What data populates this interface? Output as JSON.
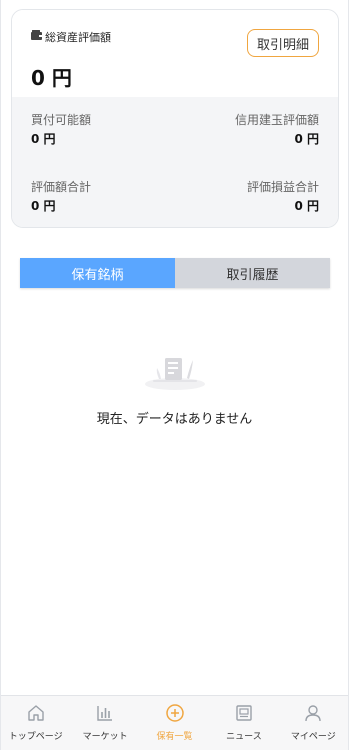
{
  "summary": {
    "total_label": "総資産評価額",
    "total_value": "0 円",
    "transaction_button": "取引明細",
    "metrics": {
      "buying_power_label": "買付可能額",
      "buying_power_value": "0 円",
      "margin_eval_label": "信用建玉評価額",
      "margin_eval_value": "0 円",
      "eval_total_label": "評価額合計",
      "eval_total_value": "0 円",
      "pl_total_label": "評価損益合計",
      "pl_total_value": "0 円"
    }
  },
  "tabs": [
    {
      "label": "保有銘柄",
      "active": true
    },
    {
      "label": "取引履歴",
      "active": false
    }
  ],
  "empty_state": {
    "message": "現在、データはありません"
  },
  "bottom_nav": [
    {
      "label": "トップページ",
      "icon": "home-icon",
      "active": false
    },
    {
      "label": "マーケット",
      "icon": "chart-icon",
      "active": false
    },
    {
      "label": "保有一覧",
      "icon": "plus-circle-icon",
      "active": true
    },
    {
      "label": "ニュース",
      "icon": "news-icon",
      "active": false
    },
    {
      "label": "マイページ",
      "icon": "user-icon",
      "active": false
    }
  ],
  "colors": {
    "accent": "#f0a640",
    "tab_active": "#5aa6ff",
    "tab_inactive": "#d3d6dc",
    "nav_inactive_icon": "#9aa0a8"
  }
}
